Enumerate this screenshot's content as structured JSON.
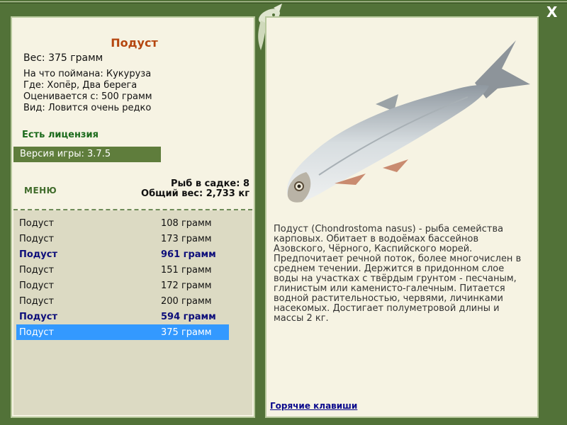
{
  "fish": {
    "name": "Подуст",
    "weight": "Вес: 375 грамм",
    "caught_on": "На что поймана: Кукуруза",
    "where": "Где: Хопёр, Два берега",
    "valued_from": "Оценивается с: 500 грамм",
    "species": "Вид: Ловится очень редко",
    "license": "Есть лицензия"
  },
  "version": "Версия игры: 3.7.5",
  "menu_label": "МЕНЮ",
  "stats": {
    "fish_count": "Рыб в садке: 8",
    "total_weight": "Общий вес: 2,733 кг"
  },
  "catch_list": [
    {
      "name": "Подуст",
      "weight": "108 грамм",
      "big": false,
      "selected": false
    },
    {
      "name": "Подуст",
      "weight": "173 грамм",
      "big": false,
      "selected": false
    },
    {
      "name": "Подуст",
      "weight": "961 грамм",
      "big": true,
      "selected": false
    },
    {
      "name": "Подуст",
      "weight": "151 грамм",
      "big": false,
      "selected": false
    },
    {
      "name": "Подуст",
      "weight": "172 грамм",
      "big": false,
      "selected": false
    },
    {
      "name": "Подуст",
      "weight": "200 грамм",
      "big": false,
      "selected": false
    },
    {
      "name": "Подуст",
      "weight": "594 грамм",
      "big": true,
      "selected": false
    },
    {
      "name": "Подуст",
      "weight": "375 грамм",
      "big": false,
      "selected": true
    }
  ],
  "description": "Подуст (Chondrostoma nasus) - рыба семейства карповых. Обитает в водоёмах бассейнов Азовского, Чёрного, Каспийского морей. Предпочитает речной поток, более многочислен в среднем течении. Держится в придонном слое воды на участках с твёрдым грунтом - песчаным, глинистым или каменисто-галечным. Питается водной растительностью, червями, личинками насекомых. Достигает полуметровой длины и массы 2 кг.",
  "hotkeys_link": "Горячие клавиши",
  "close_label": "X",
  "icons": {
    "close": "close-icon",
    "emblem": "fish-emblem-icon"
  }
}
